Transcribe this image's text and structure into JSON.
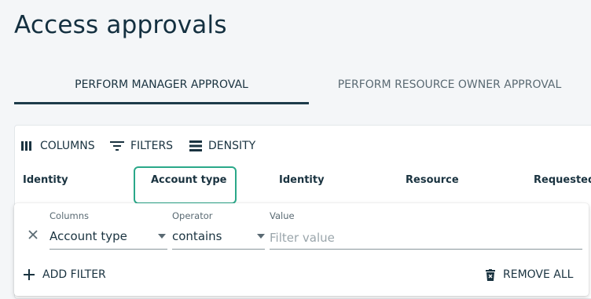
{
  "page": {
    "title": "Access approvals"
  },
  "tabs": [
    {
      "label": "PERFORM MANAGER APPROVAL",
      "selected": true
    },
    {
      "label": "PERFORM RESOURCE OWNER APPROVAL",
      "selected": false
    }
  ],
  "toolbar": {
    "columns": "COLUMNS",
    "filters": "FILTERS",
    "density": "DENSITY"
  },
  "columns": [
    "Identity",
    "Account type",
    "Identity",
    "Resource",
    "Requested by"
  ],
  "filter": {
    "columns_label": "Columns",
    "operator_label": "Operator",
    "value_label": "Value",
    "column_value": "Account type",
    "operator_value": "contains",
    "value_placeholder": "Filter value",
    "add_filter": "ADD FILTER",
    "remove_all": "REMOVE ALL"
  },
  "colors": {
    "accent": "#1d3b4a",
    "highlight": "#2aa889",
    "text": "#1a3340"
  },
  "icons": [
    "columns-icon",
    "filter-icon",
    "density-icon",
    "close-icon",
    "caret-down-icon",
    "plus-icon",
    "trash-icon"
  ]
}
